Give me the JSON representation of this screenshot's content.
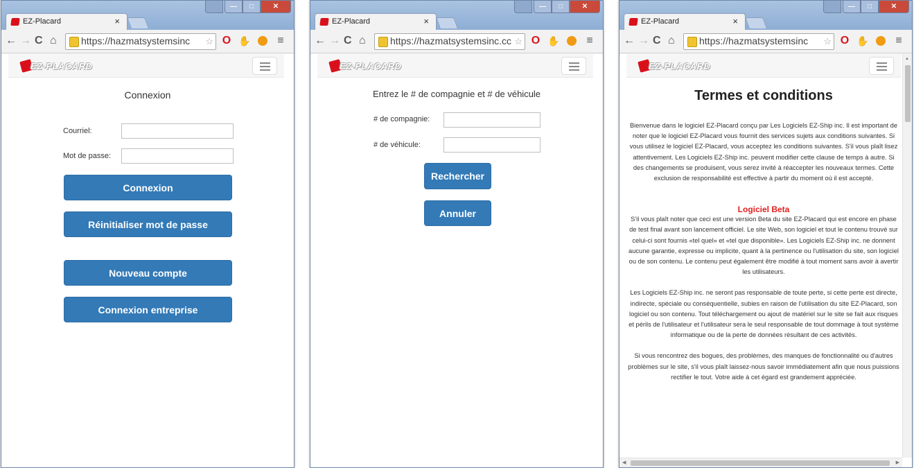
{
  "browser": {
    "tab_title": "EZ-Placard",
    "tab_close": "×",
    "url_1": "https://hazmatsystemsinc",
    "url_2": "https://hazmatsystemsinc.cc",
    "url_3": "https://hazmatsystemsinc"
  },
  "app": {
    "logo_text": "EZ-PLACARD"
  },
  "login": {
    "title": "Connexion",
    "email_label": "Courriel:",
    "email_value": "",
    "password_label": "Mot de passe:",
    "password_value": "",
    "login_button": "Connexion",
    "reset_button": "Réinitialiser mot de passe",
    "new_account_button": "Nouveau compte",
    "enterprise_button": "Connexion entreprise"
  },
  "search": {
    "title": "Entrez le # de compagnie et # de véhicule",
    "company_label": "# de compagnie:",
    "company_value": "",
    "vehicle_label": "# de véhicule:",
    "vehicle_value": "",
    "search_button": "Rechercher",
    "cancel_button": "Annuler"
  },
  "terms": {
    "title": "Termes et conditions",
    "intro": "Bienvenue dans le logiciel EZ-Placard conçu par Les Logiciels EZ-Ship inc. Il est important de noter que le logiciel EZ-Placard vous fournit des services sujets aux conditions suivantes. Si vous utilisez le logiciel EZ-Placard, vous acceptez les conditions suivantes. S'il vous plaît lisez attentivement. Les Logiciels EZ-Ship inc. peuvent modifier cette clause de temps à autre. Si des changements se produisent, vous serez invité à réaccepter les nouveaux termes. Cette exclusion de responsabilité est effective à partir du moment où il est accepté.",
    "beta_title": "Logiciel Beta",
    "beta_text": "S'il vous plaît noter que ceci est une version Beta du site EZ-Placard qui est encore en phase de test final avant son lancement officiel. Le site Web, son logiciel et tout le contenu trouvé sur celui-ci sont fournis «tel quel» et «tel que disponible». Les Logiciels EZ-Ship inc. ne donnent aucune garantie, expresse ou implicite, quant à la pertinence ou l'utilisation du site, son logiciel ou de son contenu. Le contenu peut également être modifié à tout moment sans avoir à avertir les utilisateurs.",
    "liability_text": "Les Logiciels EZ-Ship inc. ne seront pas responsable de toute perte, si cette perte est directe, indirecte, spéciale ou conséquentielle, subies en raison de l'utilisation du site EZ-Placard, son logiciel ou son contenu. Tout téléchargement ou ajout de matériel sur le site se fait aux risques et périls de l'utilisateur et l'utilisateur sera le seul responsable de tout dommage à tout système informatique ou de la perte de données résultant de ces activités.",
    "bugs_text": "Si vous rencontrez des bogues, des problèmes, des manques de fonctionnalité ou d'autres problèmes sur le site, s'il vous plaît laissez-nous savoir immédiatement afin que nous puissions rectifier le tout. Votre aide à cet égard est grandement appréciée."
  }
}
